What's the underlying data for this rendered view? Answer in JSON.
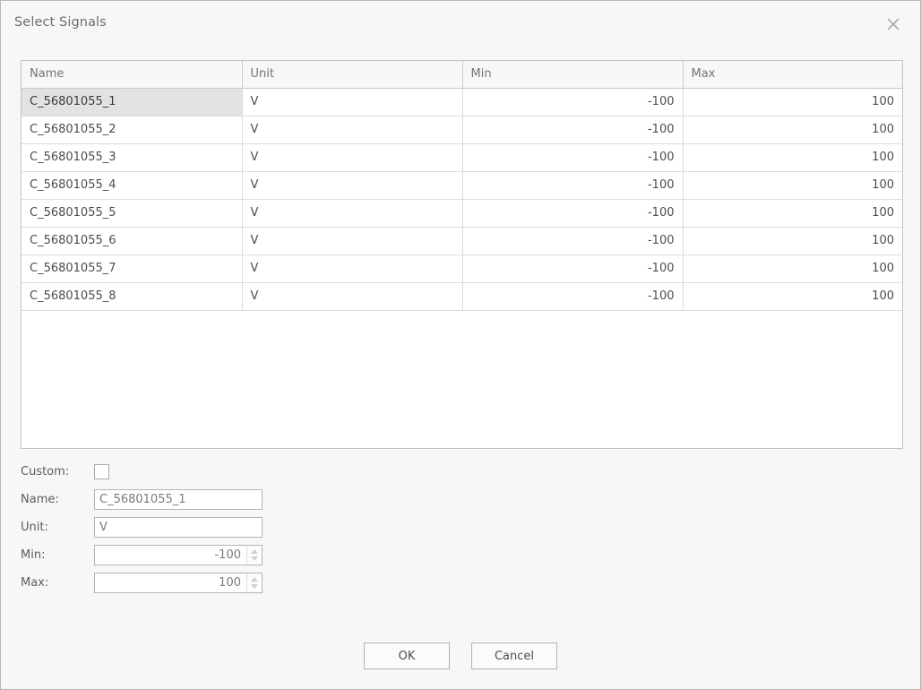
{
  "dialog": {
    "title": "Select Signals",
    "close_icon": "close-icon"
  },
  "table": {
    "columns": [
      "Name",
      "Unit",
      "Min",
      "Max"
    ],
    "rows": [
      {
        "name": "C_56801055_1",
        "unit": "V",
        "min": "-100",
        "max": "100",
        "selected": true
      },
      {
        "name": "C_56801055_2",
        "unit": "V",
        "min": "-100",
        "max": "100",
        "selected": false
      },
      {
        "name": "C_56801055_3",
        "unit": "V",
        "min": "-100",
        "max": "100",
        "selected": false
      },
      {
        "name": "C_56801055_4",
        "unit": "V",
        "min": "-100",
        "max": "100",
        "selected": false
      },
      {
        "name": "C_56801055_5",
        "unit": "V",
        "min": "-100",
        "max": "100",
        "selected": false
      },
      {
        "name": "C_56801055_6",
        "unit": "V",
        "min": "-100",
        "max": "100",
        "selected": false
      },
      {
        "name": "C_56801055_7",
        "unit": "V",
        "min": "-100",
        "max": "100",
        "selected": false
      },
      {
        "name": "C_56801055_8",
        "unit": "V",
        "min": "-100",
        "max": "100",
        "selected": false
      }
    ]
  },
  "form": {
    "custom_label": "Custom:",
    "custom_checked": false,
    "name_label": "Name:",
    "name_value": "C_56801055_1",
    "unit_label": "Unit:",
    "unit_value": "V",
    "min_label": "Min:",
    "min_value": "-100",
    "max_label": "Max:",
    "max_value": "100"
  },
  "buttons": {
    "ok": "OK",
    "cancel": "Cancel"
  }
}
